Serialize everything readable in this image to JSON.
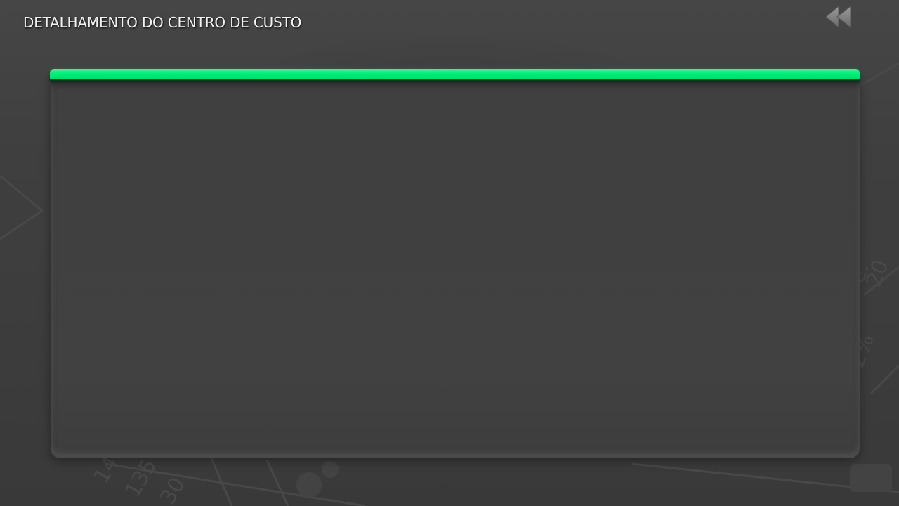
{
  "header": {
    "title": "DETALHAMENTO DO CENTRO DE CUSTO",
    "back_icon": "rewind-double-chevron-left-icon"
  },
  "panel": {
    "accent_color": "#00f078",
    "background_color": "#414141"
  },
  "background": {
    "color": "#3e3e3e"
  }
}
